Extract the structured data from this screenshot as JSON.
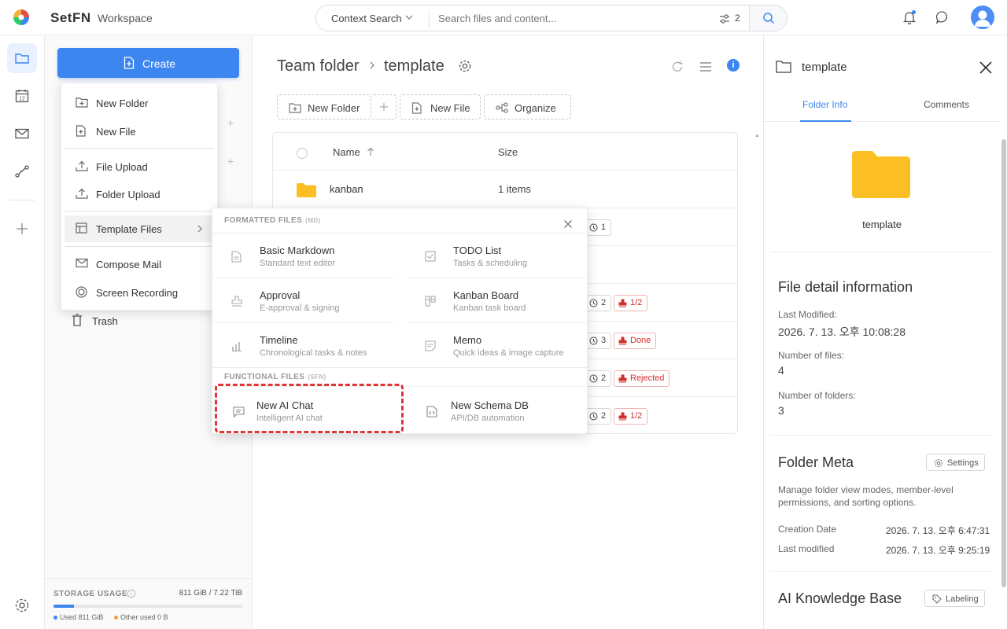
{
  "app": {
    "brand": "SetFN",
    "section": "Workspace"
  },
  "search": {
    "context_label": "Context Search",
    "placeholder": "Search files and content...",
    "filter_count": "2"
  },
  "sidebar": {
    "create_label": "Create",
    "trash_label": "Trash",
    "storage": {
      "label": "STORAGE USAGE",
      "value": "811 GiB / 7.22 TiB",
      "used_fraction": 0.11,
      "used_legend": "Used 811 GiB",
      "other_legend": "Other used 0 B"
    }
  },
  "create_menu": {
    "items": [
      {
        "label": "New Folder",
        "icon": "folder-plus-icon"
      },
      {
        "label": "New File",
        "icon": "file-plus-icon"
      },
      {
        "label": "File Upload",
        "icon": "upload-icon"
      },
      {
        "label": "Folder Upload",
        "icon": "folder-upload-icon"
      },
      {
        "label": "Template Files",
        "icon": "template-icon"
      },
      {
        "label": "Compose Mail",
        "icon": "mail-icon"
      },
      {
        "label": "Screen Recording",
        "icon": "record-icon"
      }
    ]
  },
  "template_menu": {
    "formatted_heading": "FORMATTED FILES",
    "formatted_tag": "(MD)",
    "functional_heading": "FUNCTIONAL FILES",
    "functional_tag": "(SFN)",
    "formatted": [
      {
        "title": "Basic Markdown",
        "subtitle": "Standard text editor",
        "icon": "document-icon"
      },
      {
        "title": "TODO List",
        "subtitle": "Tasks & scheduling",
        "icon": "checkbox-icon"
      },
      {
        "title": "Approval",
        "subtitle": "E-approval & signing",
        "icon": "stamp-icon"
      },
      {
        "title": "Kanban Board",
        "subtitle": "Kanban task board",
        "icon": "kanban-icon"
      },
      {
        "title": "Timeline",
        "subtitle": "Chronological tasks & notes",
        "icon": "bar-chart-icon"
      },
      {
        "title": "Memo",
        "subtitle": "Quick ideas & image capture",
        "icon": "memo-icon"
      }
    ],
    "functional": [
      {
        "title": "New AI Chat",
        "subtitle": "Intelligent AI chat",
        "icon": "chat-icon"
      },
      {
        "title": "New Schema DB",
        "subtitle": "API/DB automation",
        "icon": "code-file-icon"
      }
    ]
  },
  "main": {
    "breadcrumb": [
      "Team folder",
      "template"
    ],
    "toolbar": {
      "new_folder": "New Folder",
      "new_file": "New File",
      "organize": "Organize"
    },
    "columns": {
      "name": "Name",
      "size": "Size"
    },
    "rows": [
      {
        "name": "kanban",
        "size": "1 items"
      }
    ],
    "badges": [
      {
        "count": "1"
      },
      {
        "count": "2",
        "status": "1/2"
      },
      {
        "count": "3",
        "status": "Done"
      },
      {
        "count": "2",
        "status": "Rejected"
      },
      {
        "count": "2",
        "status": "1/2"
      }
    ]
  },
  "panel": {
    "title": "template",
    "tabs": [
      "Folder Info",
      "Comments"
    ],
    "folder_name": "template",
    "detail_heading": "File detail information",
    "last_modified_label": "Last Modified:",
    "last_modified_value": "2026. 7. 13. 오후 10:08:28",
    "files_label": "Number of files:",
    "files_value": "4",
    "folders_label": "Number of folders:",
    "folders_value": "3",
    "meta_heading": "Folder Meta",
    "settings_label": "Settings",
    "meta_desc": "Manage folder view modes, member-level permissions, and sorting options.",
    "creation_label": "Creation Date",
    "creation_value": "2026. 7. 13. 오후 6:47:31",
    "modified_label": "Last modified",
    "modified_value": "2026. 7. 13. 오후 9:25:19",
    "kb_heading": "AI Knowledge Base",
    "labeling_label": "Labeling"
  },
  "colors": {
    "accent": "#3d86ef",
    "folder": "#fbbf24",
    "danger": "#d32f2f",
    "highlight": "#e03535"
  }
}
